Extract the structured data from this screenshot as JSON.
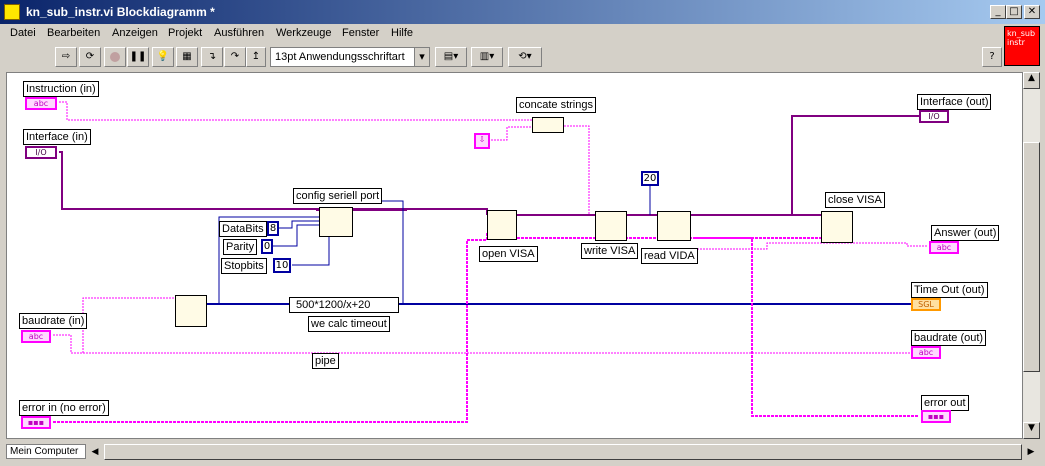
{
  "window": {
    "title": "kn_sub_instr.vi Blockdiagramm *"
  },
  "menu": [
    "Datei",
    "Bearbeiten",
    "Anzeigen",
    "Projekt",
    "Ausführen",
    "Werkzeuge",
    "Fenster",
    "Hilfe"
  ],
  "toolbar": {
    "font": "13pt Anwendungsschriftart"
  },
  "vi_icon": "kn_sub instr",
  "diagram": {
    "inputs": {
      "instruction": "Instruction (in)",
      "interface": "Interface (in)",
      "baudrate": "baudrate (in)",
      "error": "error in (no error)"
    },
    "outputs": {
      "interface": "Interface (out)",
      "answer": "Answer (out)",
      "timeout": "Time Out (out)",
      "baudrate": "baudrate (out)",
      "error": "error out"
    },
    "nodes": {
      "concat": "concate strings",
      "config": "config seriell port",
      "open": "open VISA",
      "write": "write VISA",
      "read": "read VIDA",
      "close": "close VISA",
      "calc": "we calc timeout",
      "pipe": "pipe",
      "formula": "500*1200/x+20"
    },
    "config_params": {
      "databits_label": "DataBits",
      "databits": "8",
      "parity_label": "Parity",
      "parity": "0",
      "stopbits_label": "Stopbits",
      "stopbits": "10"
    },
    "const_20": "20"
  },
  "status": {
    "context": "Mein Computer"
  },
  "colors": {
    "string_wire": "#ff00ff",
    "io_wire": "#800080",
    "numeric_wire": "#0000a0",
    "error_wire": "#c8a000"
  }
}
